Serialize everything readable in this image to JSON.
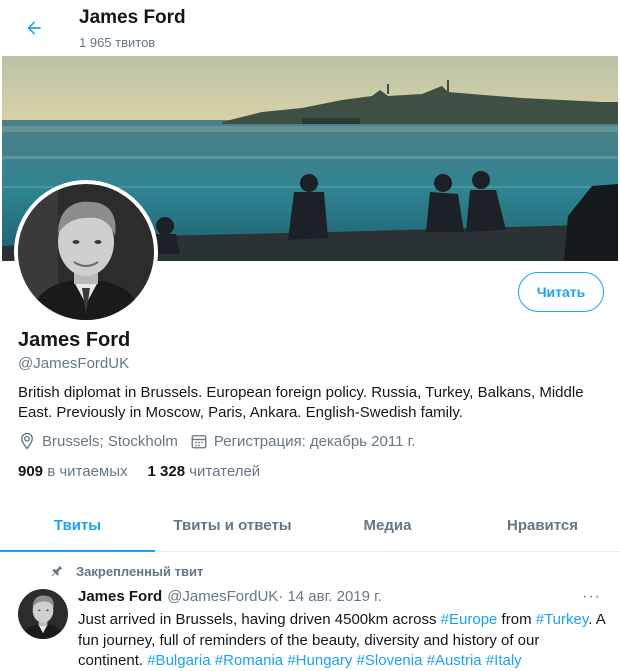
{
  "header": {
    "name": "James Ford",
    "tweet_count": "1 965 твитов"
  },
  "profile": {
    "name": "James Ford",
    "handle": "@JamesFordUK",
    "follow_label": "Читать",
    "bio_line1": "British diplomat in Brussels. European foreign policy. Russia, Turkey, Balkans, Middle",
    "bio_line2": "East. Previously in Moscow, Paris, Ankara. English-Swedish family.",
    "location": "Brussels; Stockholm",
    "joined": "Регистрация: декабрь 2011 г.",
    "following_count": "909",
    "following_label": "в читаемых",
    "followers_count": "1 328",
    "followers_label": "читателей"
  },
  "tabs": [
    {
      "label": "Твиты",
      "active": true
    },
    {
      "label": "Твиты и ответы",
      "active": false
    },
    {
      "label": "Медиа",
      "active": false
    },
    {
      "label": "Нравится",
      "active": false
    }
  ],
  "tweet": {
    "pinned_label": "Закрепленный твит",
    "author": "James Ford",
    "handle": "@JamesFordUK",
    "date": " · 14 авг. 2019 г.",
    "more": "···",
    "text_a": "Just arrived in Brussels, having driven 4500km across ",
    "tag_europe": "#Europe",
    "text_b": " from ",
    "tag_turkey": "#Turkey",
    "text_c": ". A fun journey, full of reminders of the beauty, diversity and history of our continent. ",
    "tag_bulgaria": "#Bulgaria",
    "tag_romania": "#Romania",
    "tag_hungary": "#Hungary",
    "tag_slovenia": "#Slovenia",
    "tag_austria": "#Austria",
    "tag_italy": "#Italy"
  },
  "colors": {
    "accent": "#1da1f2",
    "secondary_text": "#657786",
    "primary_text": "#14171a",
    "divider": "#e6ecf0"
  },
  "icons": {
    "back": "arrow-left-icon",
    "location": "map-pin-icon",
    "calendar": "calendar-icon",
    "pin": "pushpin-icon"
  }
}
